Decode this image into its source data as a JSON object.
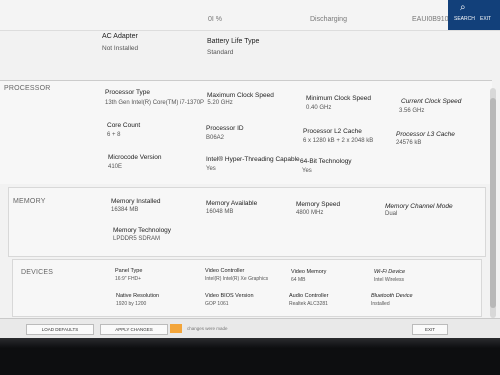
{
  "top": {
    "left_text": "0I %",
    "center_text": "Discharging",
    "right_text": "EAUI0B910",
    "search_label": "SEARCH",
    "exit_label": "EXIT"
  },
  "battery": {
    "ac_adapter_label": "AC Adapter",
    "ac_adapter_value": "Not Installed",
    "life_type_label": "Battery Life Type",
    "life_type_value": "Standard"
  },
  "processor": {
    "title": "PROCESSOR",
    "type_label": "Processor Type",
    "type_value": "13th Gen Intel(R) Core(TM) i7-1370P",
    "max_speed_label": "Maximum Clock Speed",
    "max_speed_value": "5.20 GHz",
    "min_speed_label": "Minimum Clock Speed",
    "min_speed_value": "0.40 GHz",
    "current_speed_label": "Current Clock Speed",
    "current_speed_value": "3.56 GHz",
    "core_count_label": "Core Count",
    "core_count_value": "6 + 8",
    "id_label": "Processor ID",
    "id_value": "B06A2",
    "l2_label": "Processor L2 Cache",
    "l2_value": "6 x 1280  kB + 2 x 2048  kB",
    "l3_label": "Processor L3 Cache",
    "l3_value": "24576 kB",
    "microcode_label": "Microcode Version",
    "microcode_value": "410E",
    "ht_label": "Intel® Hyper-Threading Capable",
    "ht_value": "Yes",
    "x64_label": "64-Bit Technology",
    "x64_value": "Yes"
  },
  "memory": {
    "title": "MEMORY",
    "installed_label": "Memory Installed",
    "installed_value": "16384 MB",
    "available_label": "Memory Available",
    "available_value": "16048 MB",
    "speed_label": "Memory Speed",
    "speed_value": "4800 MHz",
    "channel_label": "Memory Channel Mode",
    "channel_value": "Dual",
    "tech_label": "Memory Technology",
    "tech_value": "LPDDR5 SDRAM"
  },
  "devices": {
    "title": "DEVICES",
    "panel_label": "Panel Type",
    "panel_value": "16:9\" FHD+",
    "video_ctrl_label": "Video Controller",
    "video_ctrl_value": "Intel(R) Intel(R) Xe Graphics",
    "video_mem_label": "Video Memory",
    "video_mem_value": "64 MB",
    "wifi_label": "Wi-Fi Device",
    "wifi_value": "Intel Wireless",
    "native_res_label": "Native Resolution",
    "native_res_value": "1920 by 1200",
    "bios_label": "Video BIOS Version",
    "bios_value": "GOP 1061",
    "audio_label": "Audio Controller",
    "audio_value": "Realtek ALC3281",
    "bt_label": "Bluetooth Device",
    "bt_value": "Installed"
  },
  "footer": {
    "load_defaults": "LOAD DEFAULTS",
    "apply_changes": "APPLY CHANGES",
    "changes_hint": "changes were made",
    "exit": "EXIT"
  }
}
